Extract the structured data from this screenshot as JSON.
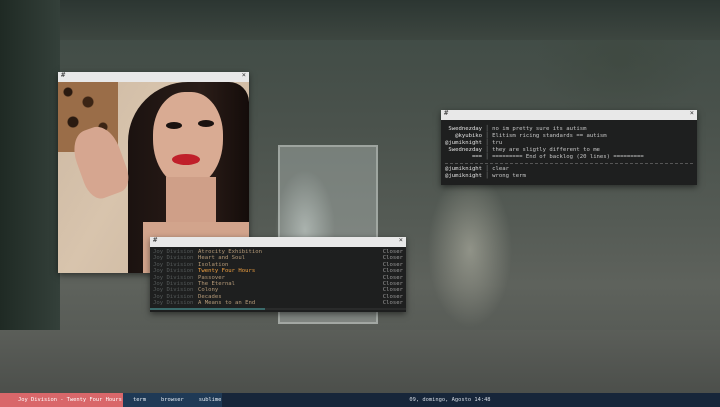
{
  "wallpaper": {
    "description_colors": [
      "#3e4a44",
      "#5e625c"
    ]
  },
  "image_viewer": {
    "title_glyph": "#",
    "close_glyph": "×"
  },
  "irc": {
    "title_glyph": "#",
    "close_glyph": "×",
    "lines": [
      {
        "nick": " Swednezday",
        "sep": "│",
        "msg": "no im pretty sure its autism"
      },
      {
        "nick": "   @kyubiko",
        "sep": "│",
        "msg": "Elitism ricing standards == autism"
      },
      {
        "nick": "@jumiknight",
        "sep": "│",
        "msg": "tru"
      },
      {
        "nick": " Swednezday",
        "sep": "│",
        "msg": "they are sligtly different to me"
      },
      {
        "nick": "        ===",
        "sep": "│",
        "msg": "========= End of backlog (20 lines) ========="
      },
      {
        "nick": "@jumiknight",
        "sep": "│",
        "msg": "clear"
      },
      {
        "nick": "@jumiknight",
        "sep": "│",
        "msg": "wrong term"
      }
    ]
  },
  "music": {
    "title_glyph": "#",
    "close_glyph": "×",
    "current_index": 3,
    "progress_fraction": 0.45,
    "tracks": [
      {
        "artist": "Joy Division",
        "title": "Atrocity Exhibition",
        "album": "Closer"
      },
      {
        "artist": "Joy Division",
        "title": "Heart and Soul",
        "album": "Closer"
      },
      {
        "artist": "Joy Division",
        "title": "Isolation",
        "album": "Closer"
      },
      {
        "artist": "Joy Division",
        "title": "Twenty Four Hours",
        "album": "Closer"
      },
      {
        "artist": "Joy Division",
        "title": "Passover",
        "album": "Closer"
      },
      {
        "artist": "Joy Division",
        "title": "The Eternal",
        "album": "Closer"
      },
      {
        "artist": "Joy Division",
        "title": "Colony",
        "album": "Closer"
      },
      {
        "artist": "Joy Division",
        "title": "Decades",
        "album": "Closer"
      },
      {
        "artist": "Joy Division",
        "title": "A Means to an End",
        "album": "Closer"
      }
    ]
  },
  "bar": {
    "now_playing": "Joy Division - Twenty Four Hours",
    "workspaces": [
      "term",
      "browser",
      "sublime"
    ],
    "clock": "09, domingo, Agosto 14:48",
    "colors": {
      "now_playing_bg": "#d9676a",
      "workspace_bg": "#1f3a56",
      "bar_bg": "#17263a"
    }
  }
}
